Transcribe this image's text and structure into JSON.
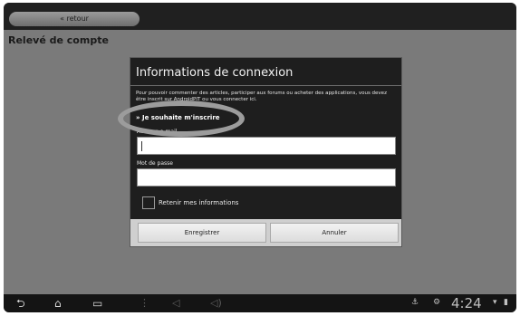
{
  "topbar": {
    "back_label": "« retour"
  },
  "page": {
    "title": "Relevé de compte"
  },
  "dialog": {
    "title": "Informations de connexion",
    "description": "Pour pouvoir commenter des articles, participer aux forums ou acheter des applications, vous devez être inscrit sur AndroidPIT ou vous connecter ici.",
    "signup_link": "» Je souhaite m'inscrire",
    "email": {
      "label": "Adresse e-mail",
      "value": ""
    },
    "password": {
      "label": "Mot de passe",
      "value": ""
    },
    "remember": {
      "label": "Retenir mes informations",
      "checked": false
    },
    "buttons": {
      "save": "Enregistrer",
      "cancel": "Annuler"
    }
  },
  "navbar": {
    "icons": [
      "back-icon",
      "home-icon",
      "recent-apps-icon",
      "menu-icon",
      "volume-down-icon",
      "volume-up-icon"
    ],
    "status_icons": [
      "usb-icon",
      "debug-icon",
      "wifi-icon",
      "battery-icon"
    ],
    "clock": "4:24"
  }
}
